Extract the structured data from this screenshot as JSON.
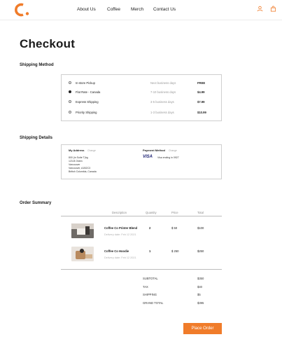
{
  "header": {
    "nav": [
      "About Us",
      "Coffee",
      "Merch",
      "Contact Us"
    ],
    "icons": {
      "user": "user-icon",
      "bag": "shopping-bag-icon"
    },
    "accent": "#f07c2a"
  },
  "page": {
    "title": "Checkout"
  },
  "shipping_method": {
    "heading": "Shipping Method",
    "options": [
      {
        "name": "In-store Pickup",
        "time": "Next business days",
        "price": "FREE",
        "selected": false
      },
      {
        "name": "Flat Rate - Canada",
        "time": "7-10 business days",
        "price": "$4.99",
        "selected": true
      },
      {
        "name": "Express Shipping",
        "time": "3-5 business days",
        "price": "$7.99",
        "selected": false
      },
      {
        "name": "Priority Shipping",
        "time": "1-3 business days",
        "price": "$10.99",
        "selected": false
      }
    ]
  },
  "shipping_details": {
    "heading": "Shipping Details",
    "address_label": "My Address",
    "address_change": "Change",
    "address_lines": [
      "800 (in Suite T)hg",
      "123-B Olden",
      "Vancouver",
      "Vancouver, A1B2C3",
      "British Columbia, Canada"
    ],
    "payment_label": "Payment Method",
    "payment_change": "Change",
    "card_brand": "VISA",
    "card_text": "Visa ending in 0927"
  },
  "order_summary": {
    "heading": "Order Summary",
    "columns": [
      "Description",
      "Quantity",
      "Price",
      "Total"
    ],
    "items": [
      {
        "name": "Coffee Co Printer Blend",
        "delivery": "Delivery date: Feb 12 2021",
        "quantity": "2",
        "price": "$ 50",
        "total": "$100"
      },
      {
        "name": "Coffee Co Hoodie",
        "delivery": "Delivery date: Feb 12 2021",
        "quantity": "1",
        "price": "$ 250",
        "total": "$250"
      }
    ],
    "totals": [
      {
        "label": "SUBTOTAL",
        "value": "$350"
      },
      {
        "label": "TAX",
        "value": "$40"
      },
      {
        "label": "SHIPPING",
        "value": "$5"
      },
      {
        "label": "GRAND TOTAL",
        "value": "$395"
      }
    ]
  },
  "actions": {
    "place_order": "Place Order"
  }
}
